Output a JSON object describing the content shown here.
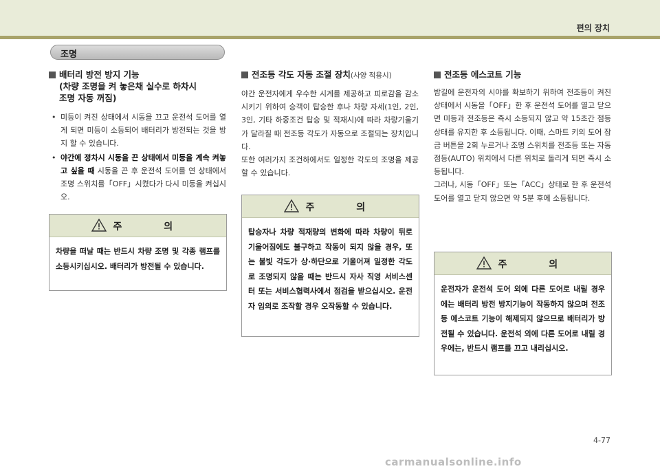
{
  "header": {
    "title": "편의 장치"
  },
  "section_pill": {
    "label": "조명"
  },
  "col1": {
    "heading_line1": "배터리 방전 방지 기능",
    "heading_line2": "(차량 조명을 켜 놓은채 실수로 하차시",
    "heading_line3": "조명 자동 꺼짐)",
    "bullet1": "미등이 켜진 상태에서 시동을 끄고 운전석 도어를 열게 되면 미등이 소등되어 배터리가 방전되는 것을 방지 할 수 있습니다.",
    "bullet2_bold": "야간에 정차시 시동을 끈 상태에서 미등을 계속 켜놓고 싶을 때",
    "bullet2_rest": " 시동을 끈 후 운전석 도어를 연 상태에서 조명 스위치를「OFF」시켰다가 다시 미등을 켜십시오.",
    "caution_title": "주 의",
    "caution_body": "차량을 떠날 때는 반드시 차량 조명 및 각종 램프를 소등시키십시오. 배터리가 방전될 수 있습니다."
  },
  "col2": {
    "heading": "전조등 각도 자동 조절 장치",
    "heading_sub": "(사양 적용시)",
    "para1": "야간 운전자에게 우수한 시계를 제공하고 피로감을 감소시키기 위하여 승객이 탑승한 후나 차량 자세(1인, 2인, 3인, 기타 하중조건 탑승 및 적재시)에 따라 차량기울기가 달라질 때 전조등 각도가 자동으로 조절되는 장치입니다.",
    "para2": "또한 여러가지 조건하에서도 일정한 각도의 조명을 제공할 수 있습니다.",
    "caution_title": "주 의",
    "caution_body": "탑승자나 차량 적재량의 변화에 따라 차량이 뒤로 기울어짐에도 불구하고 작동이 되지 않을 경우, 또는 불빛 각도가 상·하단으로 기울어져 일정한 각도로 조명되지 않을 때는 반드시 자사 직영 서비스센터 또는 서비스협력사에서 점검을 받으십시오. 운전자 임의로 조작할 경우 오작동할 수 있습니다."
  },
  "col3": {
    "heading": "전조등 에스코트 기능",
    "para1": "밤길에 운전자의 시야를 확보하기 위하여 전조등이 켜진 상태에서 시동을「OFF」한 후 운전석 도어를 열고 닫으면 미등과 전조등은 즉시 소등되지 않고 약 15초간 점등 상태를 유지한 후 소등됩니다. 이때, 스마트 키의 도어 잠금 버튼을 2회 누르거나 조명 스위치를 전조등 또는 자동 점등(AUTO) 위치에서 다른 위치로 돌리게 되면 즉시 소등됩니다.",
    "para2": "그러나, 시동「OFF」또는「ACC」상태로 한 후 운전석 도어를 열고 닫지 않으면 약 5분 후에 소등됩니다.",
    "caution_title": "주 의",
    "caution_body": "운전자가 운전석 도어 외에 다른 도어로 내릴 경우에는 배터리 방전 방지기능이 작동하지 않으며 전조등 에스코트 기능이 해제되지 않으므로 배터리가 방전될 수 있습니다. 운전석 외에 다른 도어로 내릴 경우에는, 반드시 램프를 끄고 내리십시오."
  },
  "footer": {
    "page_number": "4-77",
    "watermark": "carmanualsonline.info"
  },
  "colors": {
    "band": "#e9ecd9",
    "rule": "#a8a36a",
    "caution_head": "#e2e6cf"
  },
  "icons": {
    "caution": "warning-triangle-icon",
    "heading_marker": "square-bullet-icon"
  }
}
